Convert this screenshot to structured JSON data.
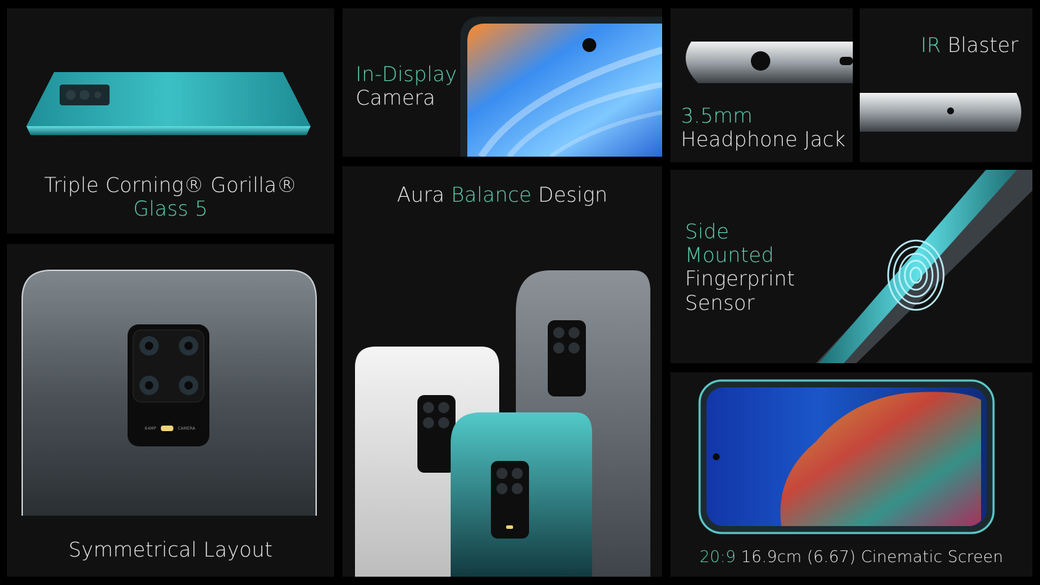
{
  "panels": {
    "glass": {
      "line1": "Triple Corning® Gorilla®",
      "line2": "Glass 5"
    },
    "camera": {
      "accent": "In-Display",
      "rest": "Camera"
    },
    "headphone": {
      "accent": "3.5mm",
      "rest": "Headphone Jack"
    },
    "ir": {
      "accent": "IR",
      "rest": " Blaster"
    },
    "aura": {
      "pre": "Aura ",
      "accent": "Balance",
      "post": " Design"
    },
    "fingerprint": {
      "accent1": "Side",
      "accent2": "Mounted",
      "rest1": "Fingerprint",
      "rest2": "Sensor"
    },
    "symmetric": {
      "label": "Symmetrical Layout",
      "module_left": "64MP",
      "module_right": "CAMERA"
    },
    "screen": {
      "accent": "20:9",
      "rest": " 16.9cm (6.67) Cinematic Screen"
    }
  },
  "colors": {
    "accent": "#5fd0b0",
    "panel_bg": "#111111",
    "aurora_blue": "#2bb5c0",
    "interstellar_grey": "#5a6067",
    "glacier_white": "#e6e6e6"
  },
  "icons": {
    "fingerprint": "fingerprint-icon",
    "camera_lens": "camera-lens-icon",
    "flash": "flash-icon"
  }
}
